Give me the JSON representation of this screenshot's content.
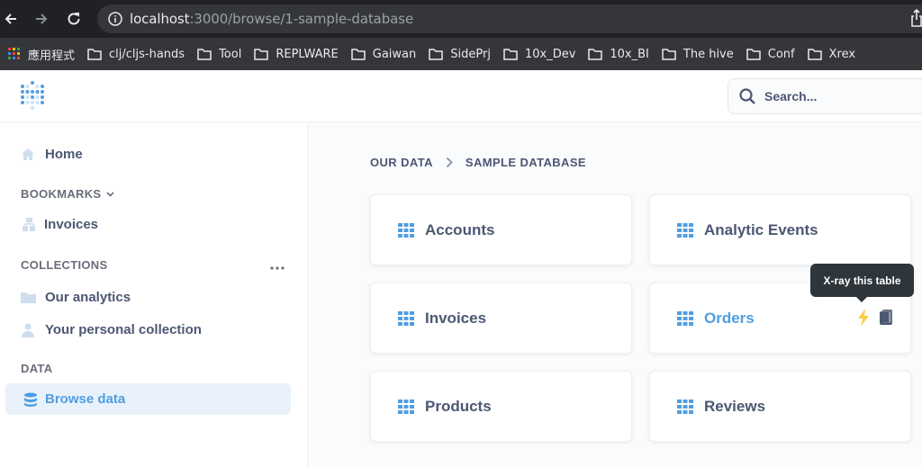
{
  "browser": {
    "url_host": "localhost",
    "url_path": ":3000/browse/1-sample-database",
    "bookmarks": [
      "應用程式",
      "clj/cljs-hands",
      "Tool",
      "REPLWARE",
      "Gaiwan",
      "SidePrj",
      "10x_Dev",
      "10x_BI",
      "The hive",
      "Conf",
      "Xrex"
    ]
  },
  "header": {
    "search_placeholder": "Search..."
  },
  "sidebar": {
    "home": "Home",
    "bookmarks_heading": "BOOKMARKS",
    "bookmark_items": [
      "Invoices"
    ],
    "collections_heading": "COLLECTIONS",
    "collection_items": [
      "Our analytics",
      "Your personal collection"
    ],
    "data_heading": "DATA",
    "browse_data": "Browse data"
  },
  "main": {
    "breadcrumb": [
      "OUR DATA",
      "SAMPLE DATABASE"
    ],
    "tables": [
      "Accounts",
      "Analytic Events",
      "Invoices",
      "Orders",
      "Products",
      "Reviews"
    ],
    "tooltip": "X-ray this table"
  },
  "colors": {
    "brand": "#509ee3",
    "text": "#4c5773",
    "xray": "#f9cf48"
  }
}
